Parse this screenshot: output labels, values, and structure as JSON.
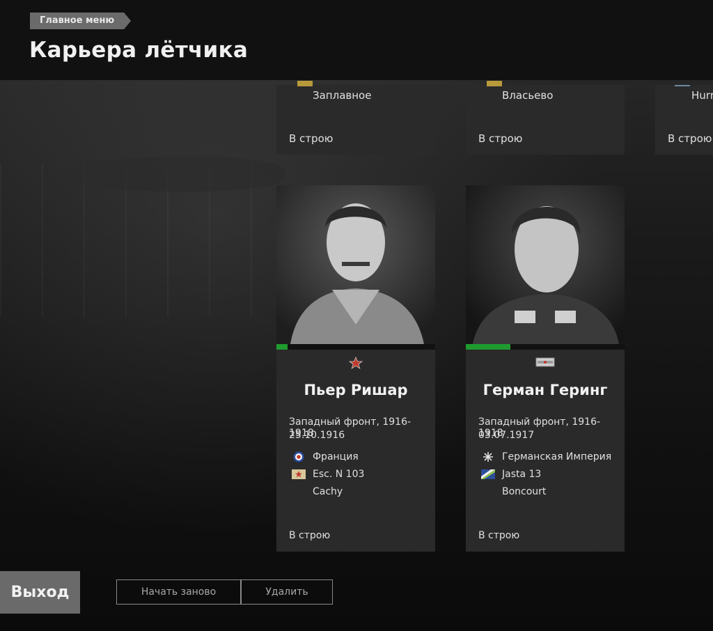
{
  "header": {
    "breadcrumb": "Главное меню",
    "title": "Карьера лётчика"
  },
  "top_cards": [
    {
      "place": "Заплавное",
      "status": "В строю"
    },
    {
      "place": "Власьево",
      "status": "В строю"
    },
    {
      "place": "Hurr",
      "status": "В строю"
    }
  ],
  "pilots": [
    {
      "name": "Пьер Ришар",
      "theater": "Западный фронт, 1916-1918",
      "date": "25.10.1916",
      "country": "Франция",
      "unit": "Esc. N 103",
      "base": "Cachy",
      "status": "В строю",
      "progress": 0.07,
      "rank_icon": "star-rank-icon",
      "country_icon": "french-roundel-icon",
      "unit_icon": "squadron-flag-icon"
    },
    {
      "name": "Герман Геринг",
      "theater": "Западный фронт, 1916-1918",
      "date": "03.07.1917",
      "country": "Германская Империя",
      "unit": "Jasta 13",
      "base": "Boncourt",
      "status": "В строю",
      "progress": 0.28,
      "rank_icon": "shoulder-board-icon",
      "country_icon": "iron-cross-icon",
      "unit_icon": "jasta-emblem-icon"
    }
  ],
  "buttons": {
    "exit": "Выход",
    "restart": "Начать заново",
    "delete": "Удалить"
  },
  "colors": {
    "progress": "#1f9a2f",
    "card": "#2a2a2a",
    "breadcrumb": "#6b6b6b"
  }
}
